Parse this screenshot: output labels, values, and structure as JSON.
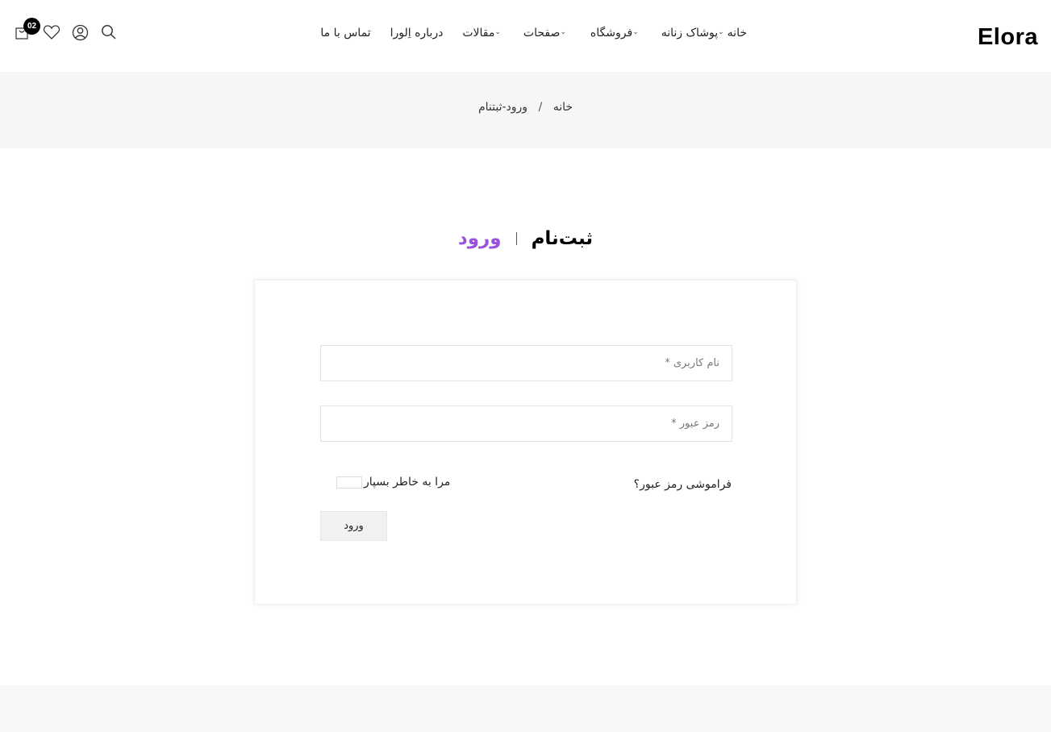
{
  "header": {
    "logo": "Elora",
    "nav": [
      {
        "label": "خانه",
        "has_dropdown": false
      },
      {
        "label": "پوشاک زنانه",
        "has_dropdown": true
      },
      {
        "label": "فروشگاه",
        "has_dropdown": true
      },
      {
        "label": "صفحات",
        "has_dropdown": true
      },
      {
        "label": "مقالات",
        "has_dropdown": true
      },
      {
        "label": "درباره اِلورا",
        "has_dropdown": false
      },
      {
        "label": "تماس با ما",
        "has_dropdown": false
      }
    ],
    "icons": [
      "search-icon",
      "user-icon",
      "heart-icon",
      "cart-icon"
    ],
    "cart_count": "02"
  },
  "breadcrumb": {
    "home": "خانه",
    "separator": "/",
    "current": "ورود-ثبتنام"
  },
  "tabs": {
    "register": "ثبت‌نام",
    "login": "ورود",
    "accent_color": "#9a51dd"
  },
  "form": {
    "username_placeholder": "نام کاربری *",
    "password_placeholder": "رمز عبور *",
    "forgot_label": "فراموشی رمز عبور؟",
    "remember_label": "مرا به خاطر بسپار",
    "submit_label": "ورود"
  }
}
